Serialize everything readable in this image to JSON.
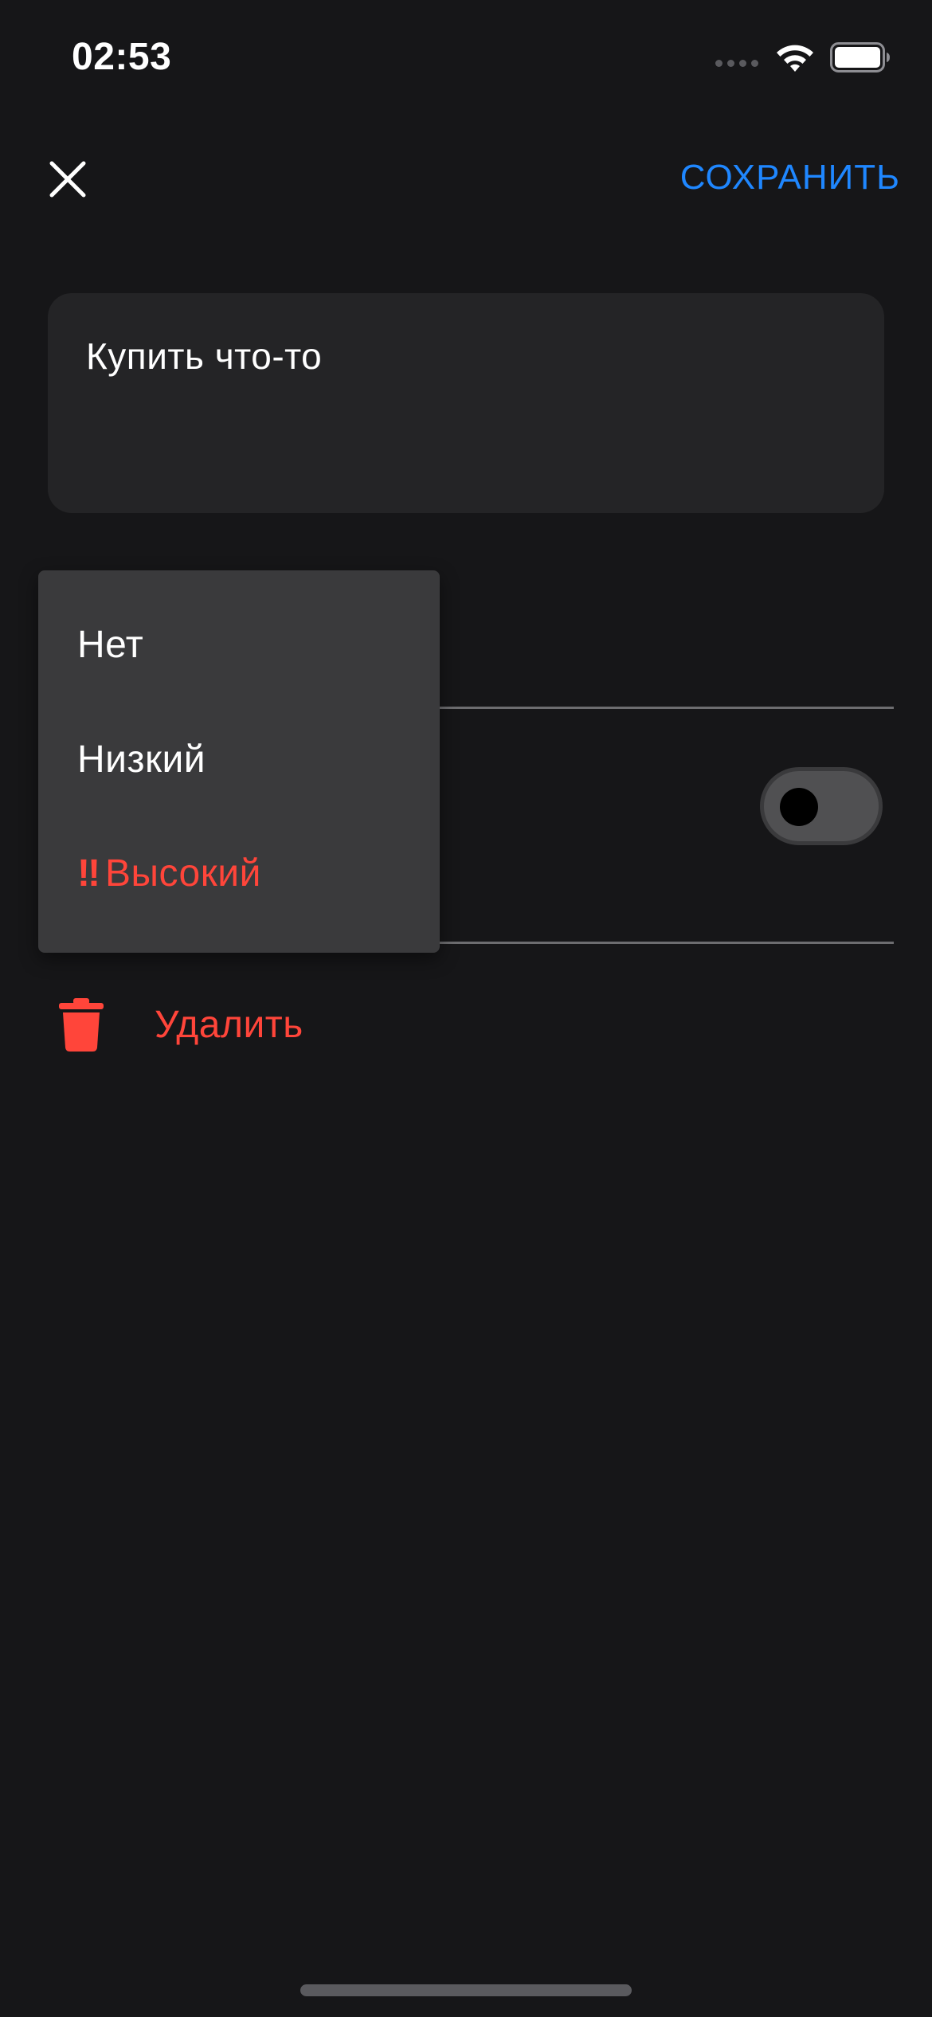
{
  "status_bar": {
    "time": "02:53",
    "icons": [
      "signal-icon",
      "wifi-icon",
      "battery-icon"
    ]
  },
  "top_bar": {
    "close_icon": "close-icon",
    "save_label": "СОХРАНИТЬ"
  },
  "task": {
    "text": "Купить что-то"
  },
  "priority_menu": {
    "items": [
      {
        "label": "Нет",
        "mark": ""
      },
      {
        "label": "Низкий",
        "mark": ""
      },
      {
        "label": "Высокий",
        "mark": "‼"
      }
    ]
  },
  "deadline_toggle": {
    "on": false
  },
  "delete": {
    "label": "Удалить",
    "icon": "trash-icon"
  },
  "colors": {
    "background": "#161618",
    "card": "#242426",
    "menu": "#3a3a3c",
    "accent_blue": "#1f87ff",
    "danger_red": "#ff453a"
  }
}
